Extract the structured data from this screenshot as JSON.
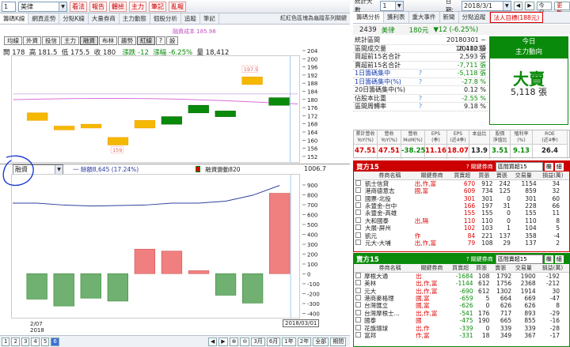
{
  "left": {
    "code_combo": "1",
    "stock_name": "美律",
    "func_buttons": [
      "看法",
      "報告",
      "體檢",
      "主力",
      "筆記",
      "亂報"
    ],
    "tabs": [
      "籌碼K線",
      "網頁走勢",
      "分點K線",
      "大量券商",
      "主力動態",
      "個股分析",
      "追蹤",
      "筆記"
    ],
    "top_links": "紅紅色區塊為龜蹤系列關鍵",
    "sub_buttons": [
      "均線",
      "外資",
      "投信",
      "主力",
      "融資",
      "布林",
      "趨勢",
      "紅線",
      "?",
      "設"
    ],
    "stats": {
      "open": "開 178",
      "high": "高 181.5",
      "low": "低 175.5",
      "close": "收 180",
      "change": "漲跌 -12",
      "pct": "漲幅 -6.25%",
      "volume": "量 18,412"
    },
    "legend_top": "融資成本 185.98",
    "y_labels_top": [
      "204",
      "200",
      "196",
      "192",
      "188",
      "184",
      "180",
      "176",
      "172",
      "168",
      "164",
      "160",
      "156",
      "152"
    ],
    "panel2_select": "融資",
    "panel2_legend1": "一 餘額8,645 (17.24%)",
    "panel2_legend2": "融資變動820",
    "panel2_max": "1006.7",
    "y_labels_bottom": [
      "900",
      "800",
      "700",
      "600",
      "500",
      "400",
      "300",
      "200",
      "100",
      "0",
      "-100",
      "-200",
      "-300",
      "-400"
    ],
    "x_labels": [
      "2/07",
      "2018"
    ],
    "date_box": "2018/03/01",
    "pages": [
      "1",
      "2",
      "3",
      "4",
      "5",
      "6"
    ],
    "period_buttons": [
      "3月",
      "6月",
      "1年",
      "2年",
      "全部",
      "期間"
    ]
  },
  "chart_data": {
    "type": "candlestick",
    "price": {
      "ylim": [
        150,
        206
      ],
      "cost_line": 185.98,
      "candles": [
        {
          "open": 172,
          "close": 176,
          "high": 176,
          "low": 172,
          "up": true
        },
        {
          "open": 167,
          "close": 169,
          "high": 169,
          "low": 167,
          "up": true
        },
        {
          "open": 168,
          "close": 170,
          "high": 170,
          "low": 168,
          "up": true
        },
        {
          "open": 159,
          "close": 163,
          "high": 163,
          "low": 159,
          "up": true
        },
        {
          "open": 168,
          "close": 172,
          "high": 172,
          "low": 168,
          "up": true
        },
        {
          "open": 174,
          "close": 170,
          "high": 174,
          "low": 170,
          "up": false
        },
        {
          "open": 180,
          "close": 176,
          "high": 180,
          "low": 176,
          "up": false
        },
        {
          "open": 177,
          "close": 174,
          "high": 177,
          "low": 174,
          "up": false
        },
        {
          "open": 191,
          "close": 195,
          "high": 197.5,
          "low": 191,
          "up": true
        },
        {
          "open": 184,
          "close": 180,
          "high": 184,
          "low": 180,
          "up": false
        }
      ],
      "labels": [
        {
          "text": "197.5"
        },
        {
          "text": "159"
        }
      ]
    },
    "margin": {
      "ylim": [
        -450,
        1010
      ],
      "bars": [
        -260,
        -330,
        -250,
        -280,
        250,
        230,
        30,
        -220,
        -300,
        820
      ],
      "balance": [
        720,
        700,
        690,
        695,
        700,
        720,
        720,
        740,
        800,
        900
      ]
    }
  },
  "right": {
    "label_count": "統計天數",
    "combo": "1",
    "date_label": "日期:",
    "date": "2018/3/1",
    "today": "今日",
    "refresh": "更新",
    "tabs": [
      "籌碼分析",
      "獲利表",
      "重大事件",
      "新聞",
      "分點追蹤",
      "法人目標(188元)"
    ],
    "stock": {
      "code": "2439",
      "name": "美律",
      "price": "180元",
      "change": "▼12 (-6.25%)"
    },
    "stats": [
      {
        "l": "統計區間",
        "v": "20180301 ~ 2018030"
      },
      {
        "l": "區間成交量",
        "v": "18,412 張"
      },
      {
        "l": "買超前15名合計",
        "v": "2,593 張"
      },
      {
        "l": "賣超前15名合計",
        "v": "-7,711 張"
      },
      {
        "l": "1日籌碼集中",
        "v": "-5,118 張",
        "q": "?"
      },
      {
        "l": "1日籌碼集中(%)",
        "v": "-27.8 %",
        "q": "?"
      },
      {
        "l": "20日籌碼集中(%)",
        "v": "0.12 %"
      },
      {
        "l": "佔股本比重",
        "v": "-2.55 %",
        "q": "?"
      },
      {
        "l": "區間周轉率",
        "v": "9.18 %",
        "q": "?"
      }
    ],
    "green_header1": "今日",
    "green_header2": "主力動向",
    "big_sell": "大賣",
    "sell_qty": "5,118 張",
    "fin_headers": [
      "累計營收\nYoY(%)",
      "營收\nYoY(%)",
      "營收\nMoM(%)",
      "EPS\n(季)",
      "EPS\n(近4季)",
      "本益比",
      "股價\n淨值比",
      "殖利率\n(%)",
      "ROE\n(近4季)"
    ],
    "fin_values": [
      "47.51",
      "47.51",
      "-38.25",
      "11.16",
      "18.07",
      "13.9",
      "3.51",
      "9.13",
      "26.4"
    ],
    "buy_title": "買方15",
    "buy_hint": "? 關鍵券商",
    "buy_select": "區間買超15",
    "btn_tab": "欄",
    "btn_add": "細",
    "cols": [
      "券商名稱",
      "關鍵券商",
      "買賣超",
      "買張",
      "賣張",
      "交易量",
      "損益(萬)"
    ],
    "buy_rows": [
      [
        "凱士信貸",
        "出,作,富",
        "670",
        "912",
        "242",
        "1154",
        "34"
      ],
      [
        "港商德意志",
        "國,富",
        "609",
        "734",
        "125",
        "859",
        "32"
      ],
      [
        "國票-北投",
        "",
        "301",
        "301",
        "0",
        "301",
        "60"
      ],
      [
        "永豐金-台中",
        "",
        "166",
        "197",
        "31",
        "228",
        "66"
      ],
      [
        "永豐金-高雄",
        "",
        "155",
        "155",
        "0",
        "155",
        "11"
      ],
      [
        "大和國泰",
        "出,隔",
        "110",
        "110",
        "0",
        "110",
        "8"
      ],
      [
        "大展-屏州",
        "",
        "102",
        "103",
        "1",
        "104",
        "5"
      ],
      [
        "凱元",
        "作",
        "84",
        "221",
        "137",
        "358",
        "-4"
      ],
      [
        "元大-大埔",
        "出,作,富",
        "79",
        "108",
        "29",
        "137",
        "2"
      ]
    ],
    "sell_title": "賣方15",
    "sell_hint": "? 關鍵券商",
    "sell_select": "區間賣超15",
    "sell_rows": [
      [
        "摩根大通",
        "出",
        "-1684",
        "108",
        "1792",
        "1900",
        "-192"
      ],
      [
        "美林",
        "出,作,富",
        "-1144",
        "612",
        "1756",
        "2368",
        "-212"
      ],
      [
        "元大",
        "出,作,富",
        "-690",
        "612",
        "1302",
        "1914",
        "30"
      ],
      [
        "港商麥格理",
        "國,富",
        "-659",
        "5",
        "664",
        "669",
        "-47"
      ],
      [
        "台灣匯立",
        "國,富",
        "-626",
        "0",
        "626",
        "626",
        "8"
      ],
      [
        "台灣摩根士...",
        "出,作,富",
        "-541",
        "176",
        "717",
        "893",
        "-29"
      ],
      [
        "國泰",
        "國",
        "-475",
        "190",
        "665",
        "855",
        "-16"
      ],
      [
        "花旗環球",
        "出,作",
        "-339",
        "0",
        "339",
        "339",
        "-28"
      ],
      [
        "富邦",
        "作,富",
        "-331",
        "18",
        "349",
        "367",
        "-17"
      ]
    ]
  }
}
